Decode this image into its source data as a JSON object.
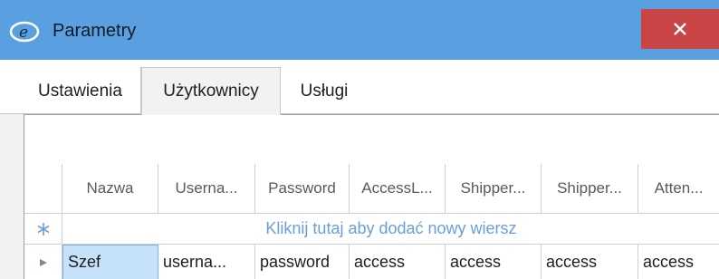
{
  "window": {
    "title": "Parametry",
    "close_label": "✕"
  },
  "tabs": [
    {
      "label": "Ustawienia"
    },
    {
      "label": "Użytkownicy"
    },
    {
      "label": "Usługi"
    }
  ],
  "grid": {
    "columns": [
      "Nazwa",
      "Userna...",
      "Password",
      "AccessL...",
      "Shipper...",
      "Shipper...",
      "Atten..."
    ],
    "new_row_hint": "Kliknij tutaj aby dodać nowy wiersz",
    "rows": [
      [
        "Szef",
        "userna...",
        "password",
        "access",
        "access",
        "access",
        "access"
      ]
    ]
  },
  "colors": {
    "titlebar": "#5aa0e0",
    "close": "#c94545",
    "hint_text": "#6a9ed8",
    "selected_cell": "#c6e2fb"
  }
}
